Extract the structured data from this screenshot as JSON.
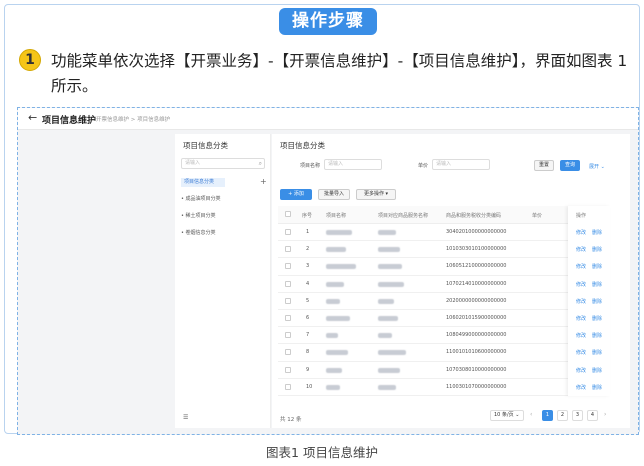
{
  "header": {
    "badge": "操作步骤"
  },
  "step": {
    "number": "1",
    "text": "功能菜单依次选择【开票业务】-【开票信息维护】-【项目信息维护】，界面如图表 1所示。"
  },
  "screenshot": {
    "topbar": {
      "back_icon": "←",
      "title": "项目信息维护",
      "breadcrumb": "开票信息维护 > 项目信息维护"
    },
    "left": {
      "title": "项目信息分类",
      "search_placeholder": "请输入",
      "search_icon": "⌕",
      "selected": "项目信息分类",
      "plus": "+",
      "items": [
        "• 成品油项目分类",
        "• 稀土项目分类",
        "• 卷烟信息分类"
      ],
      "bottom_icon": "☰"
    },
    "right": {
      "title": "项目信息分类",
      "filters": [
        {
          "label": "项目名称",
          "placeholder": "请输入"
        },
        {
          "label": "单价",
          "placeholder": "请输入"
        }
      ],
      "reset": "重置",
      "query": "查询",
      "expand": "展开 ⌄",
      "toolbar": {
        "add": "+ 添加",
        "import": "批量导入",
        "more": "更多操作 ▾"
      },
      "columns": [
        "序号",
        "项目名称",
        "项目对应商品服务名称",
        "商品和服务税收分类编码",
        "单价",
        "操作"
      ],
      "rows": [
        {
          "no": "1",
          "code": "3040201000000000000"
        },
        {
          "no": "2",
          "code": "1010303010100000000"
        },
        {
          "no": "3",
          "code": "1060512100000000000"
        },
        {
          "no": "4",
          "code": "1070214010000000000"
        },
        {
          "no": "5",
          "code": "2020000000000000000"
        },
        {
          "no": "6",
          "code": "1060201015900000000"
        },
        {
          "no": "7",
          "code": "1080499000000000000"
        },
        {
          "no": "8",
          "code": "1100101010600000000"
        },
        {
          "no": "9",
          "code": "1070308010000000000"
        },
        {
          "no": "10",
          "code": "1100301070000000000"
        }
      ],
      "actions": {
        "edit": "修改",
        "delete": "删除"
      },
      "pagination": {
        "total": "共 12 条",
        "size": "10 条/页 ⌄",
        "prev": "‹",
        "next": "›",
        "pages": [
          "1",
          "2",
          "3",
          "4"
        ]
      }
    }
  },
  "caption": "图表1 项目信息维护"
}
